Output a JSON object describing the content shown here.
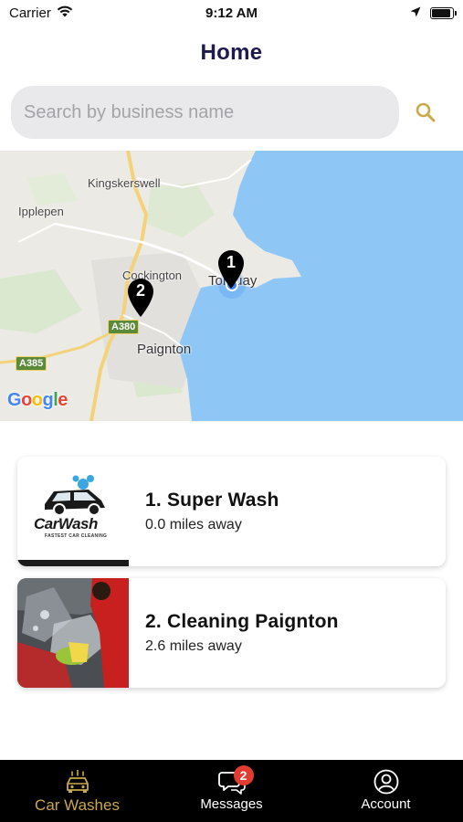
{
  "status": {
    "carrier": "Carrier",
    "time": "9:12 AM",
    "battery_level": 0.9
  },
  "header": {
    "title": "Home"
  },
  "search": {
    "placeholder": "Search by business name",
    "value": "",
    "icon": "search-icon",
    "accent": "#c9a94a"
  },
  "map": {
    "places": [
      "Kingskerswell",
      "Ipplepen",
      "Cockington",
      "Torquay",
      "Paignton"
    ],
    "roads": [
      "A380",
      "A385"
    ],
    "attribution": "Google",
    "pins": [
      {
        "number": "1"
      },
      {
        "number": "2"
      }
    ]
  },
  "listings": [
    {
      "name": "1. Super Wash",
      "distance": "0.0 miles away",
      "logo_text": "CarWash",
      "logo_tagline": "FASTEST CAR CLEANING"
    },
    {
      "name": "2. Cleaning Paignton",
      "distance": "2.6 miles away"
    }
  ],
  "tabbar": {
    "items": [
      {
        "label": "Car Washes",
        "icon": "car-wash-icon",
        "active": true
      },
      {
        "label": "Messages",
        "icon": "chat-icon",
        "badge": "2"
      },
      {
        "label": "Account",
        "icon": "account-icon"
      }
    ]
  },
  "colors": {
    "title": "#1d1a4e",
    "accent": "#c9a94a",
    "sea": "#8ec7f5",
    "badge": "#e23b30"
  }
}
